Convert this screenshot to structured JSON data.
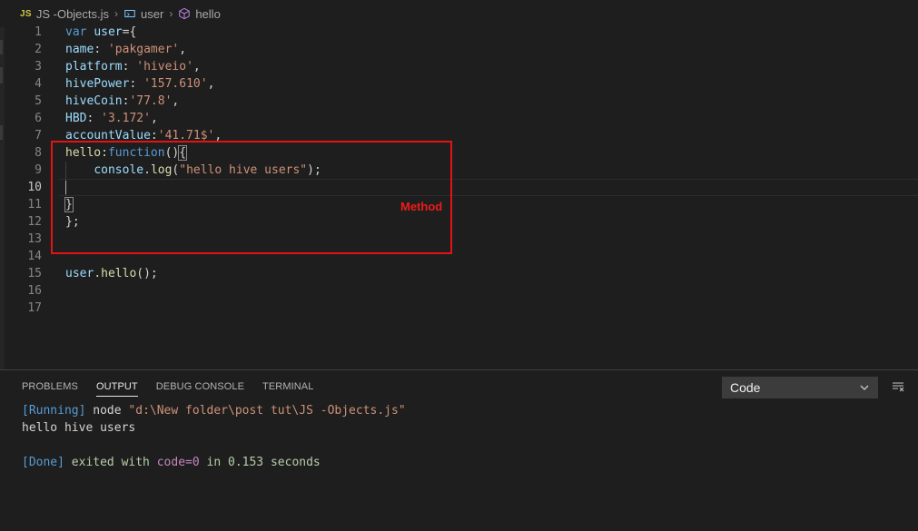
{
  "breadcrumb": {
    "file_icon": "JS",
    "file": "JS -Objects.js",
    "object": "user",
    "method": "hello"
  },
  "editor": {
    "lines": [
      {
        "n": "1",
        "tokens": [
          [
            "kw",
            "var "
          ],
          [
            "var",
            "user"
          ],
          [
            "punc",
            "={"
          ]
        ]
      },
      {
        "n": "2",
        "tokens": [
          [
            "var",
            "name"
          ],
          [
            "punc",
            ": "
          ],
          [
            "str",
            "'pakgamer'"
          ],
          [
            "punc",
            ","
          ]
        ]
      },
      {
        "n": "3",
        "tokens": [
          [
            "var",
            "platform"
          ],
          [
            "punc",
            ": "
          ],
          [
            "str",
            "'hiveio'"
          ],
          [
            "punc",
            ","
          ]
        ]
      },
      {
        "n": "4",
        "tokens": [
          [
            "var",
            "hivePower"
          ],
          [
            "punc",
            ": "
          ],
          [
            "str",
            "'157.610'"
          ],
          [
            "punc",
            ","
          ]
        ]
      },
      {
        "n": "5",
        "tokens": [
          [
            "var",
            "hiveCoin"
          ],
          [
            "punc",
            ":"
          ],
          [
            "str",
            "'77.8'"
          ],
          [
            "punc",
            ","
          ]
        ]
      },
      {
        "n": "6",
        "tokens": [
          [
            "var",
            "HBD"
          ],
          [
            "punc",
            ": "
          ],
          [
            "str",
            "'3.172'"
          ],
          [
            "punc",
            ","
          ]
        ]
      },
      {
        "n": "7",
        "tokens": [
          [
            "var",
            "accountValue"
          ],
          [
            "punc",
            ":"
          ],
          [
            "str",
            "'41.71$'"
          ],
          [
            "punc",
            ","
          ]
        ]
      },
      {
        "n": "8",
        "tokens": [
          [
            "fn",
            "hello"
          ],
          [
            "punc",
            ":"
          ],
          [
            "kw",
            "function"
          ],
          [
            "punc",
            "()"
          ],
          [
            "punc-match",
            "{"
          ]
        ]
      },
      {
        "n": "9",
        "tokens": [
          [
            "punc",
            "    "
          ],
          [
            "var",
            "console"
          ],
          [
            "punc",
            "."
          ],
          [
            "fn",
            "log"
          ],
          [
            "punc",
            "("
          ],
          [
            "str",
            "\"hello hive users\""
          ],
          [
            "punc",
            ");"
          ]
        ]
      },
      {
        "n": "10",
        "tokens": []
      },
      {
        "n": "11",
        "tokens": [
          [
            "punc-match",
            "}"
          ]
        ]
      },
      {
        "n": "12",
        "tokens": [
          [
            "punc",
            "};"
          ]
        ]
      },
      {
        "n": "13",
        "tokens": []
      },
      {
        "n": "14",
        "tokens": []
      },
      {
        "n": "15",
        "tokens": [
          [
            "var",
            "user"
          ],
          [
            "punc",
            "."
          ],
          [
            "fn",
            "hello"
          ],
          [
            "punc",
            "();"
          ]
        ]
      },
      {
        "n": "16",
        "tokens": []
      },
      {
        "n": "17",
        "tokens": []
      }
    ],
    "current_line": "10"
  },
  "annotation": {
    "label": "Method",
    "color": "#e41313"
  },
  "panel": {
    "tabs": [
      {
        "label": "PROBLEMS",
        "active": false
      },
      {
        "label": "OUTPUT",
        "active": true
      },
      {
        "label": "DEBUG CONSOLE",
        "active": false
      },
      {
        "label": "TERMINAL",
        "active": false
      }
    ],
    "output_channel": "Code",
    "output": {
      "running_tag": "[Running]",
      "running_cmd": " node ",
      "running_path": "\"d:\\New folder\\post tut\\JS -Objects.js\"",
      "result": "hello hive users",
      "done_tag": "[Done]",
      "done_text_1": " exited with ",
      "done_code": "code=0",
      "done_text_2": " in ",
      "done_time": "0.153",
      "done_text_3": " seconds"
    }
  }
}
